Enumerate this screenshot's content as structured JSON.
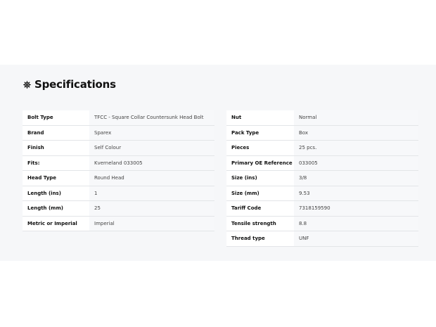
{
  "section": {
    "title": "Specifications",
    "icon": "gear-icon"
  },
  "left": [
    {
      "label": "Bolt Type",
      "value": "TFCC - Square Collar Countersunk Head Bolt"
    },
    {
      "label": "Brand",
      "value": "Sparex"
    },
    {
      "label": "Finish",
      "value": "Self Colour"
    },
    {
      "label": "Fits:",
      "value": "Kverneland 033005"
    },
    {
      "label": "Head Type",
      "value": "Round Head"
    },
    {
      "label": "Length (ins)",
      "value": "1"
    },
    {
      "label": "Length (mm)",
      "value": "25"
    },
    {
      "label": "Metric or Imperial",
      "value": "Imperial"
    }
  ],
  "right": [
    {
      "label": "Nut",
      "value": "Normal"
    },
    {
      "label": "Pack Type",
      "value": "Box"
    },
    {
      "label": "Pieces",
      "value": "25 pcs."
    },
    {
      "label": "Primary OE Reference",
      "value": "033005"
    },
    {
      "label": "Size (ins)",
      "value": "3/8"
    },
    {
      "label": "Size (mm)",
      "value": "9.53"
    },
    {
      "label": "Tariff Code",
      "value": "7318159590"
    },
    {
      "label": "Tensile strength",
      "value": "8.8"
    },
    {
      "label": "Thread type",
      "value": "UNF"
    }
  ]
}
